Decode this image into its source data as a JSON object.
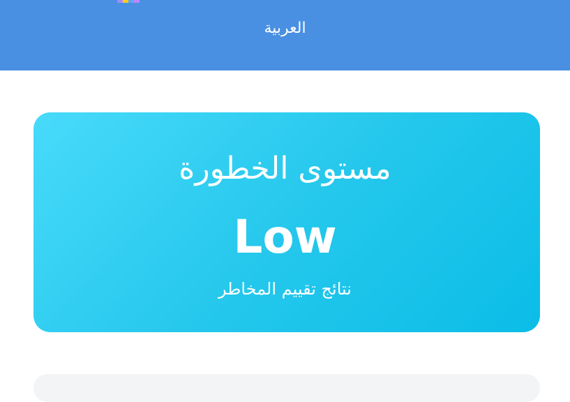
{
  "header": {
    "language_link": "العربية",
    "logo_icon": "colorful-logo-icon"
  },
  "risk_card": {
    "title": "مستوى الخطورة",
    "value": "Low",
    "subtitle": "نتائج تقييم المخاطر"
  },
  "colors": {
    "header_bg": "#4a90e2",
    "card_gradient_start": "#48dafb",
    "card_gradient_end": "#0bbde7",
    "text": "#ffffff"
  }
}
